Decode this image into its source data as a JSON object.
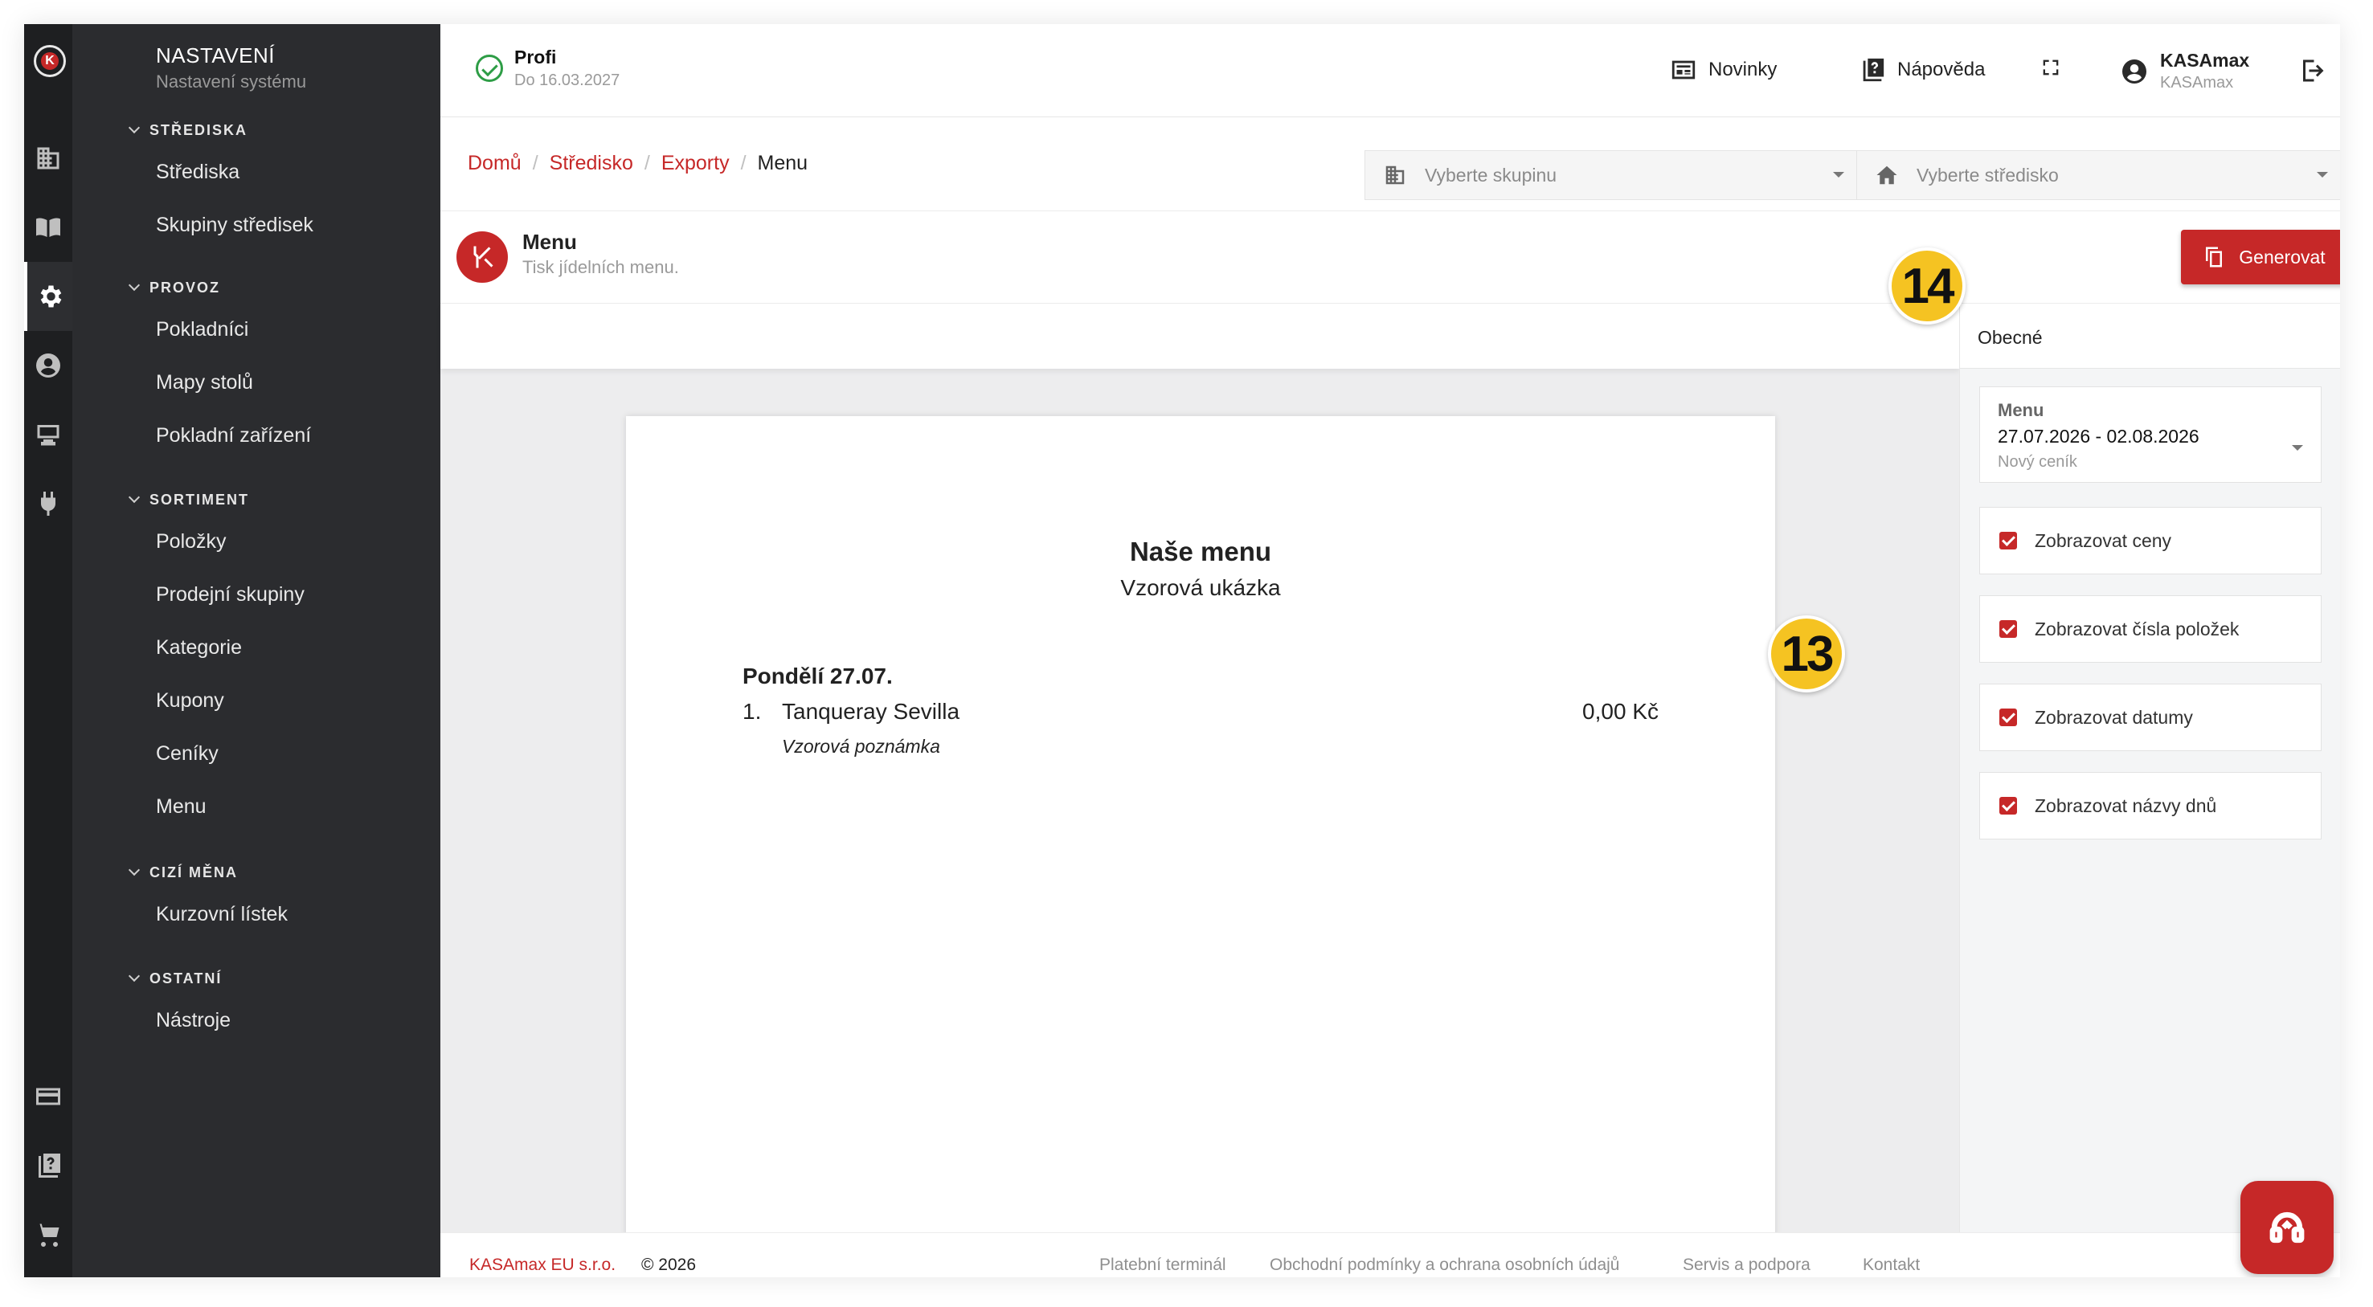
{
  "sidebar": {
    "title": "NASTAVENÍ",
    "subtitle": "Nastavení systému",
    "sections": [
      {
        "title": "STŘEDISKA",
        "items": [
          "Střediska",
          "Skupiny středisek"
        ]
      },
      {
        "title": "PROVOZ",
        "items": [
          "Pokladníci",
          "Mapy stolů",
          "Pokladní zařízení"
        ]
      },
      {
        "title": "SORTIMENT",
        "items": [
          "Položky",
          "Prodejní skupiny",
          "Kategorie",
          "Kupony",
          "Ceníky",
          "Menu"
        ]
      },
      {
        "title": "CIZÍ MĚNA",
        "items": [
          "Kurzovní lístek"
        ]
      },
      {
        "title": "OSTATNÍ",
        "items": [
          "Nástroje"
        ]
      }
    ],
    "rail_icons": [
      "building-icon",
      "book-icon",
      "gear-icon",
      "user-circle-icon",
      "pos-terminal-icon",
      "plug-icon",
      "credit-card-icon",
      "help-book-icon",
      "cart-icon"
    ]
  },
  "topbar": {
    "plan_name": "Profi",
    "plan_valid": "Do 16.03.2027",
    "news_label": "Novinky",
    "help_label": "Nápověda",
    "user_name": "KASAmax",
    "user_company": "KASAmax"
  },
  "breadcrumb": [
    "Domů",
    "Středisko",
    "Exporty",
    "Menu"
  ],
  "filters": {
    "group_placeholder": "Vyberte skupinu",
    "center_placeholder": "Vyberte středisko"
  },
  "page": {
    "title": "Menu",
    "subtitle": "Tisk jídelních menu.",
    "generate_label": "Generovat"
  },
  "preview": {
    "title": "Naše menu",
    "subtitle": "Vzorová ukázka",
    "day": "Pondělí 27.07.",
    "item_number": "1.",
    "item_name": "Tanqueray Sevilla",
    "item_price": "0,00 Kč",
    "item_note": "Vzorová poznámka"
  },
  "settings": {
    "tab": "Obecné",
    "menu_label": "Menu",
    "menu_value": "27.07.2026 - 02.08.2026",
    "menu_pricelist": "Nový ceník",
    "checkboxes": [
      "Zobrazovat ceny",
      "Zobrazovat čísla položek",
      "Zobrazovat datumy",
      "Zobrazovat názvy dnů"
    ]
  },
  "badges": {
    "settings": "13",
    "generate": "14"
  },
  "footer": {
    "company": "KASAmax EU s.r.o.",
    "copyright": "© 2026",
    "links": [
      "Platební terminál",
      "Obchodní podmínky a ochrana osobních údajů",
      "Servis a podpora",
      "Kontakt"
    ]
  },
  "colors": {
    "accent": "#c62828",
    "badge": "#f5c322",
    "sidebar": "#2b2c2f",
    "rail": "#1e1f21"
  }
}
